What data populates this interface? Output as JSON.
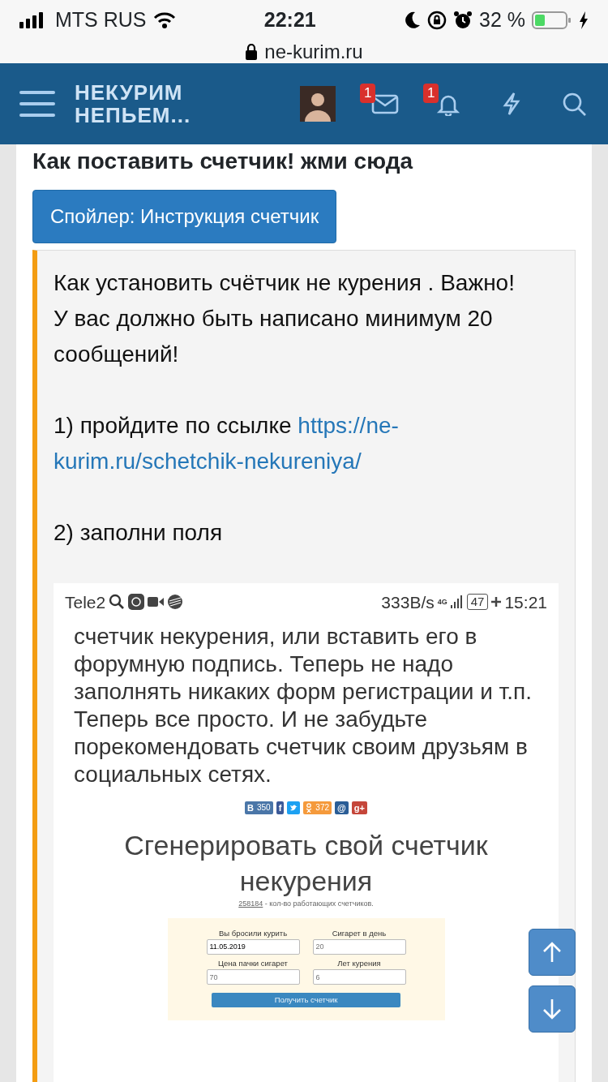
{
  "status_bar": {
    "carrier": "MTS RUS",
    "time": "22:21",
    "battery": "32 %"
  },
  "address_bar": {
    "url": "ne-kurim.ru"
  },
  "header": {
    "logo_lines": [
      "НЕКУРИМ",
      "НЕПЬЕМ..."
    ],
    "messages_badge": "1",
    "alerts_badge": "1"
  },
  "post": {
    "title": "Как поставить счетчик! жми сюда",
    "spoiler_button": "Спойлер: Инструкция счетчик",
    "quote": [
      {
        "text": "Как установить счётчик не курения . Важно! У вас должно быть написано минимум 20 сообщений!"
      },
      {
        "text": "1) пройдите по ссылке",
        "link_lines": [
          "https://ne-",
          "kurim.ru/schetchik-nekureniya/"
        ]
      },
      {
        "text": "2) заполни поля"
      }
    ],
    "embedded_screenshot": {
      "status_bar": {
        "carrier": "Tele2",
        "speed": "333B/s",
        "network": "4G",
        "battery": "47",
        "time": "15:21"
      },
      "body_text": "счетчик некурения, или вставить его в форумную подпись. Теперь не надо заполнять никаких форм регистрации и т.п. Теперь все просто. И не забудьте порекомендовать счетчик своим друзьям в социальных сетях.",
      "share_buttons": [
        {
          "kind": "vk",
          "glyph": "В",
          "count": "350",
          "color": "#4a76a8"
        },
        {
          "kind": "facebook",
          "glyph": "f",
          "color": "#3b5998"
        },
        {
          "kind": "twitter",
          "color": "#1da1f2"
        },
        {
          "kind": "odnoklassniki",
          "count": "372",
          "color": "#f59a3c"
        },
        {
          "kind": "mail",
          "glyph": "@",
          "color": "#2a5d96"
        },
        {
          "kind": "googleplus",
          "glyph": "g+",
          "color": "#c5463a"
        }
      ],
      "heading": "Сгенерировать свой счетчик некурения",
      "counter_number": "258184",
      "counter_caption": "- кол-во работающих счетчиков.",
      "form_fields": [
        {
          "label": "Вы бросили курить",
          "value": "11.05.2019"
        },
        {
          "label": "Сигарет в день",
          "placeholder": "20"
        },
        {
          "label": "Цена пачки сигарет",
          "placeholder": "70"
        },
        {
          "label": "Лет курения",
          "placeholder": "6"
        }
      ],
      "submit_button": "Получить счетчик"
    }
  }
}
